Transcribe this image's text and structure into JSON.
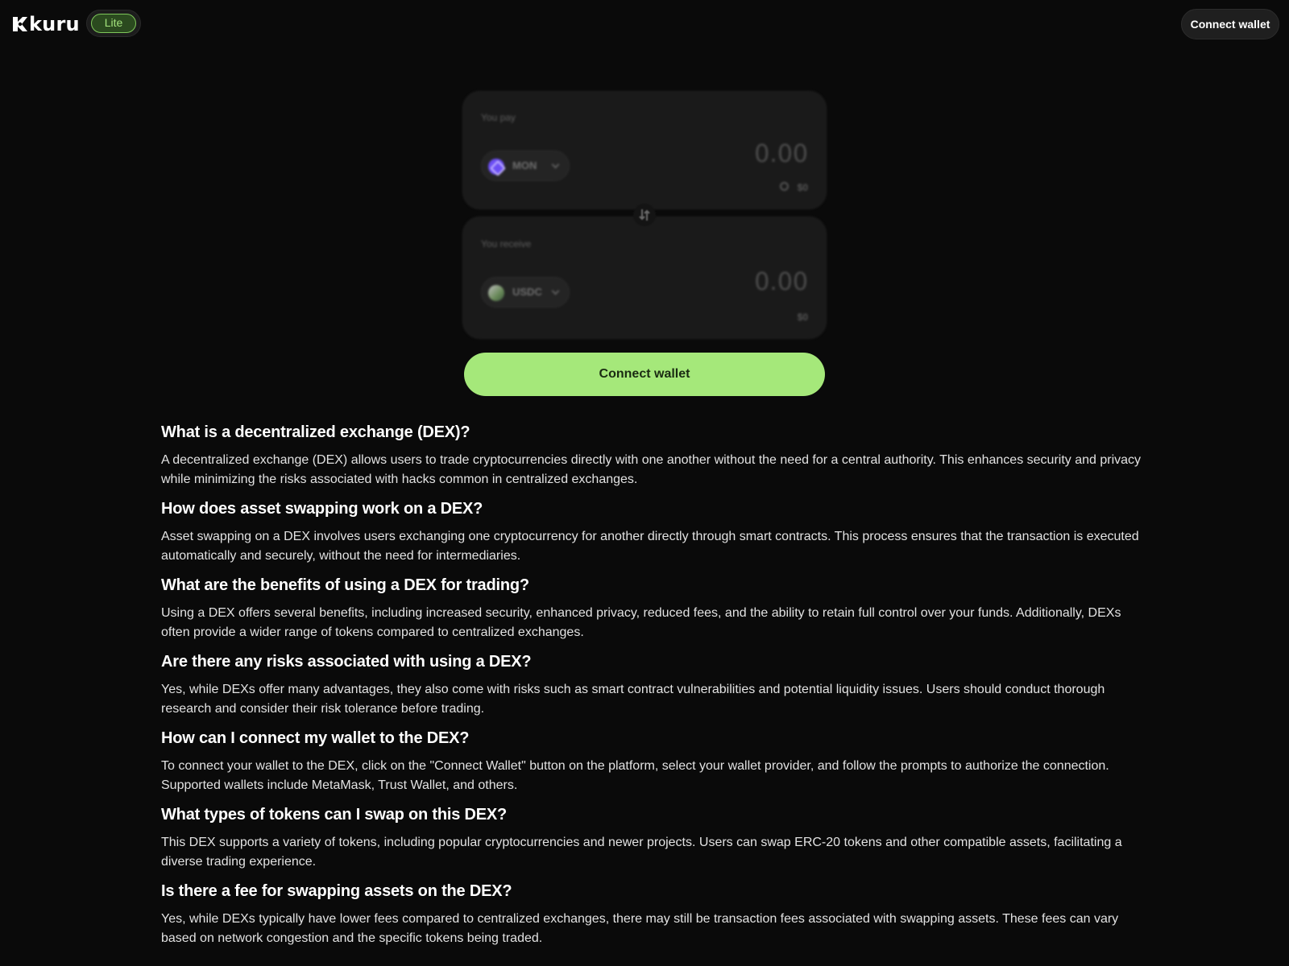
{
  "header": {
    "logo_text": "kuru",
    "badge": "Lite",
    "connect_label": "Connect wallet"
  },
  "swap": {
    "pay": {
      "label": "You pay",
      "token": "MON",
      "amount": "0.00",
      "usd": "$0"
    },
    "receive": {
      "label": "You receive",
      "token": "USDC",
      "amount": "0.00",
      "usd": "$0"
    },
    "connect_label": "Connect wallet"
  },
  "faq": [
    {
      "q": "What is a decentralized exchange (DEX)?",
      "a": "A decentralized exchange (DEX) allows users to trade cryptocurrencies directly with one another without the need for a central authority. This enhances security and privacy while minimizing the risks associated with hacks common in centralized exchanges."
    },
    {
      "q": "How does asset swapping work on a DEX?",
      "a": "Asset swapping on a DEX involves users exchanging one cryptocurrency for another directly through smart contracts. This process ensures that the transaction is executed automatically and securely, without the need for intermediaries."
    },
    {
      "q": "What are the benefits of using a DEX for trading?",
      "a": "Using a DEX offers several benefits, including increased security, enhanced privacy, reduced fees, and the ability to retain full control over your funds. Additionally, DEXs often provide a wider range of tokens compared to centralized exchanges."
    },
    {
      "q": "Are there any risks associated with using a DEX?",
      "a": "Yes, while DEXs offer many advantages, they also come with risks such as smart contract vulnerabilities and potential liquidity issues. Users should conduct thorough research and consider their risk tolerance before trading."
    },
    {
      "q": "How can I connect my wallet to the DEX?",
      "a": "To connect your wallet to the DEX, click on the \"Connect Wallet\" button on the platform, select your wallet provider, and follow the prompts to authorize the connection. Supported wallets include MetaMask, Trust Wallet, and others."
    },
    {
      "q": "What types of tokens can I swap on this DEX?",
      "a": "This DEX supports a variety of tokens, including popular cryptocurrencies and newer projects. Users can swap ERC-20 tokens and other compatible assets, facilitating a diverse trading experience."
    },
    {
      "q": "Is there a fee for swapping assets on the DEX?",
      "a": "Yes, while DEXs typically have lower fees compared to centralized exchanges, there may still be transaction fees associated with swapping assets. These fees can vary based on network congestion and the specific tokens being traded."
    }
  ],
  "colors": {
    "background": "#0a0a0a",
    "accent": "#a5e87a",
    "badge_text": "#a3e27c",
    "panel": "#1a1a1a"
  },
  "icons": {
    "logo": "kuru-logo-icon",
    "pay_token": "mon-token-icon",
    "receive_token": "usdc-token-icon",
    "swap_direction": "swap-arrows-icon",
    "gas": "gas-icon",
    "dropdown": "chevron-down-icon"
  }
}
